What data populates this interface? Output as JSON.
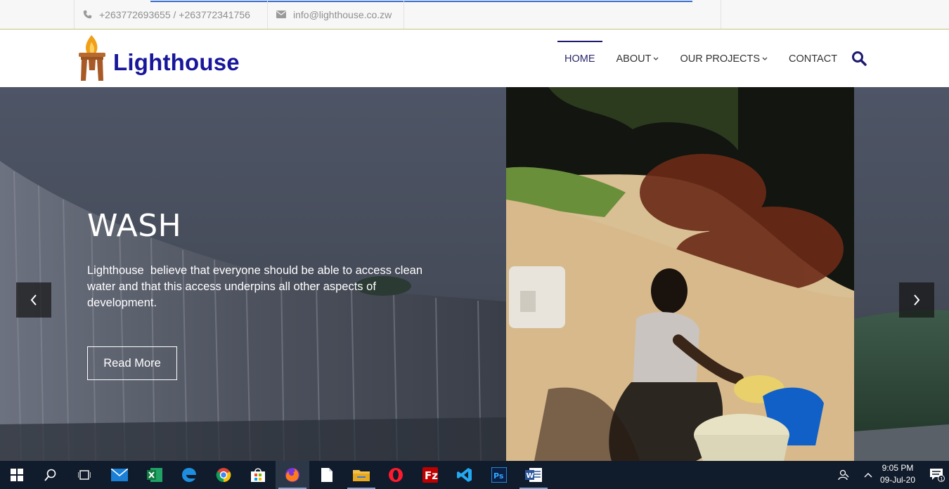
{
  "topbar": {
    "phone": "+263772693655 / +263772341756",
    "email": "info@lighthouse.co.zw"
  },
  "header": {
    "brand": "Lighthouse",
    "nav": [
      {
        "label": "HOME",
        "active": true,
        "dropdown": false
      },
      {
        "label": "ABOUT",
        "active": false,
        "dropdown": true
      },
      {
        "label": "OUR PROJECTS",
        "active": false,
        "dropdown": true
      },
      {
        "label": "CONTACT",
        "active": false,
        "dropdown": false
      }
    ]
  },
  "slide": {
    "title": "WASH",
    "text": "Lighthouse  believe that everyone should be able to access clean water and that this access underpins all other aspects of development.",
    "cta": "Read More"
  },
  "taskbar": {
    "apps": [
      "start-icon",
      "search-icon",
      "task-view-icon",
      "mail-icon",
      "excel-icon",
      "edge-icon",
      "chrome-icon",
      "store-icon",
      "firefox-icon",
      "file-icon",
      "file-explorer-icon",
      "opera-icon",
      "filezilla-icon",
      "vscode-icon",
      "photoshop-icon",
      "word-icon"
    ],
    "time": "9:05 PM",
    "date": "09-Jul-20",
    "notification_count": "1"
  },
  "colors": {
    "brand": "#18169a",
    "nav_active": "#1d1a70",
    "taskbar": "#101b2b"
  }
}
